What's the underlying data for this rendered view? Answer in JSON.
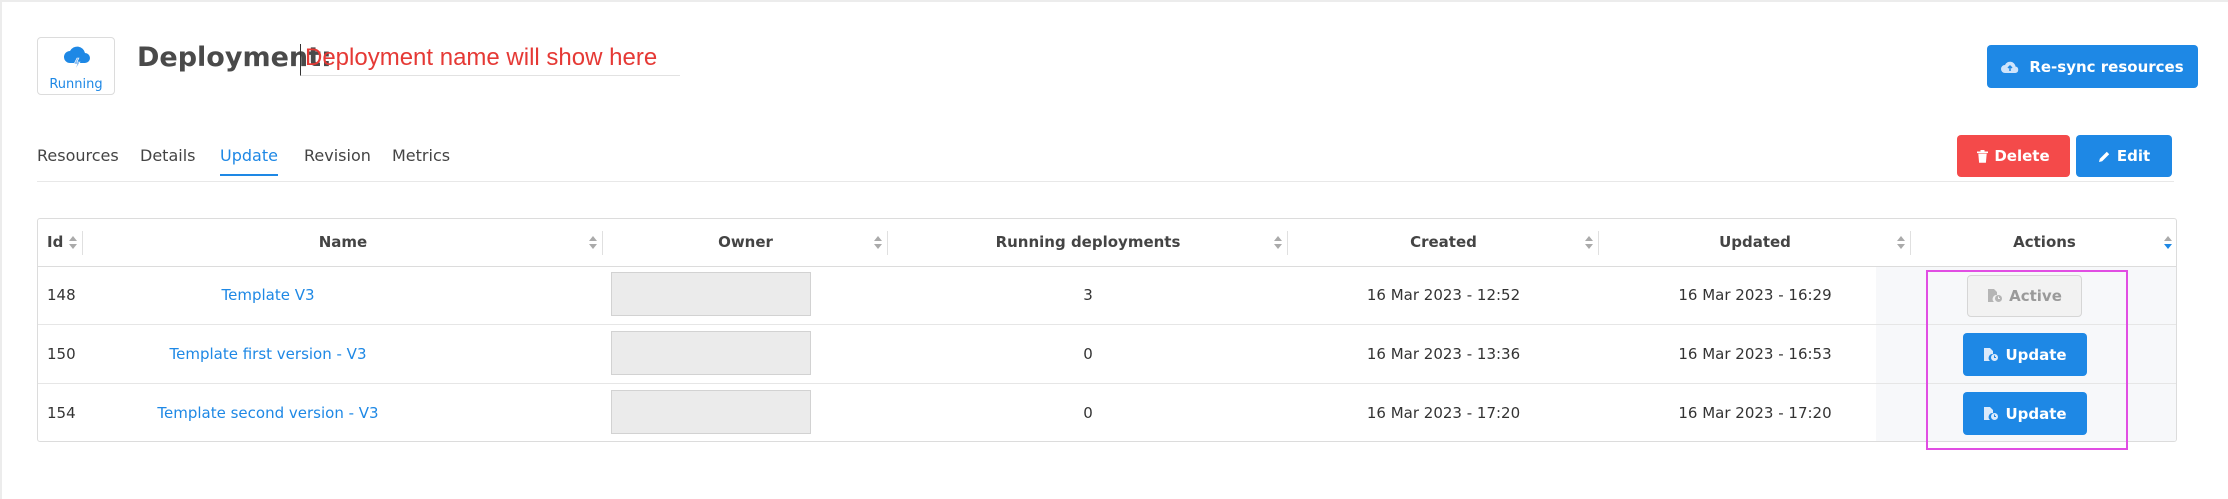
{
  "header": {
    "status": "Running",
    "title": "Deployment:",
    "deployment_name": "Deployment name will show here",
    "resync_label": "Re-sync resources"
  },
  "tabs": [
    {
      "label": "Resources"
    },
    {
      "label": "Details"
    },
    {
      "label": "Update",
      "active": true
    },
    {
      "label": "Revision"
    },
    {
      "label": "Metrics"
    }
  ],
  "toolbar": {
    "delete_label": "Delete",
    "edit_label": "Edit"
  },
  "table": {
    "columns": [
      "Id",
      "Name",
      "Owner",
      "Running deployments",
      "Created",
      "Updated",
      "Actions"
    ],
    "rows": [
      {
        "id": "148",
        "name": "Template V3",
        "owner": "",
        "running": "3",
        "created": "16 Mar 2023 - 12:52",
        "updated": "16 Mar 2023 - 16:29",
        "action": "Active"
      },
      {
        "id": "150",
        "name": "Template first version - V3",
        "owner": "",
        "running": "0",
        "created": "16 Mar 2023 - 13:36",
        "updated": "16 Mar 2023 - 16:53",
        "action": "Update"
      },
      {
        "id": "154",
        "name": "Template second version - V3",
        "owner": "",
        "running": "0",
        "created": "16 Mar 2023 - 17:20",
        "updated": "16 Mar 2023 - 17:20",
        "action": "Update"
      }
    ]
  },
  "colors": {
    "primary": "#1e88e5",
    "danger": "#f44a4a",
    "name_placeholder": "#e53935",
    "highlight": "#e14ee3"
  },
  "icons": {
    "status": "cloud-lightning-icon",
    "resync": "cloud-upload-icon",
    "delete": "trash-icon",
    "edit": "pencil-icon",
    "action": "file-clock-icon"
  }
}
